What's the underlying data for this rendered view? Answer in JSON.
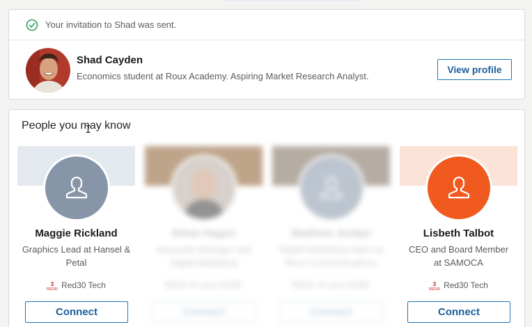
{
  "notice": {
    "text": "Your invitation to Shad was sent.",
    "icon": "check-circle-icon"
  },
  "invited": {
    "name": "Shad Cayden",
    "title": "Economics student at Roux Academy. Aspiring Market Research Analyst.",
    "view_profile_label": "View profile"
  },
  "pymk": {
    "title": "People you may know",
    "suggestions": [
      {
        "name": "Maggie Rickland",
        "title": "Graphics Lead at Hansel & Petal",
        "org": "Red30 Tech",
        "connect_label": "Connect",
        "avatar": "default-person-icon",
        "avatar_color": "#8795a8",
        "band_color": "#e3e9ef"
      },
      {
        "name": "Ethan Hagen",
        "title": "Associate Manager and Digital Marketing",
        "org": "Match on your profile",
        "connect_label": "Connect",
        "avatar": "photo",
        "band_color": "#8a5a2a"
      },
      {
        "name": "Matthew Jordan",
        "title": "Digital Marketing Intern at Roux Communications",
        "org": "Match on your profile",
        "connect_label": "Connect",
        "avatar": "default-person-icon",
        "avatar_color": "#8795a8",
        "band_color": "#7a6a5a"
      },
      {
        "name": "Lisbeth Talbot",
        "title": "CEO and Board Member at SAMOCA",
        "org": "Red30 Tech",
        "connect_label": "Connect",
        "avatar": "default-person-icon",
        "avatar_color": "#f05a1f",
        "band_color": "#fbe3d8"
      }
    ]
  },
  "colors": {
    "accent": "#1b74b8",
    "success": "#2e9e5b"
  }
}
